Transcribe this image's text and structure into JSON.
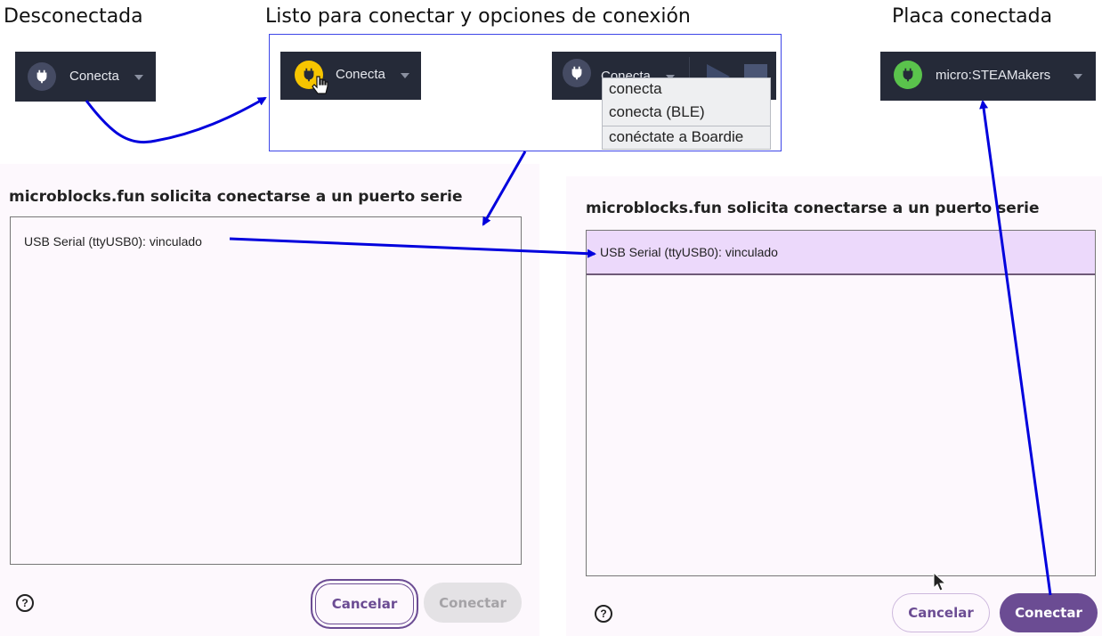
{
  "captions": {
    "disconnected": "Desconectada",
    "ready": "Listo para conectar y opciones de conexión",
    "connected": "Placa conectada"
  },
  "toolbar": {
    "disconnected_label": "Conecta",
    "ready_label": "Conecta",
    "menu_label": "Conecta",
    "connected_label": "micro:STEAMakers"
  },
  "connect_menu": {
    "items": [
      "conecta",
      "conecta (BLE)",
      "conéctate a Boardie"
    ]
  },
  "dialog_left": {
    "title": "microblocks.fun solicita conectarse a un puerto serie",
    "port": "USB Serial (ttyUSB0): vinculado",
    "help": "?",
    "cancel": "Cancelar",
    "connect": "Conectar"
  },
  "dialog_right": {
    "title": "microblocks.fun solicita conectarse a un puerto serie",
    "port": "USB Serial (ttyUSB0): vinculado",
    "help": "?",
    "cancel": "Cancelar",
    "connect": "Conectar"
  },
  "colors": {
    "toolbar_bg": "#252a38",
    "plug_disconnected": "#454b63",
    "plug_ready": "#f7c500",
    "plug_connected": "#5ac34c",
    "accent_purple": "#6b4c93",
    "selected_port_bg": "#ecd9fb",
    "arrow_blue": "#0000dd"
  },
  "icons": [
    "plug-icon",
    "hand-pointer-icon",
    "play-icon",
    "stop-icon",
    "help-icon",
    "mouse-cursor-icon",
    "caret-down-icon"
  ]
}
